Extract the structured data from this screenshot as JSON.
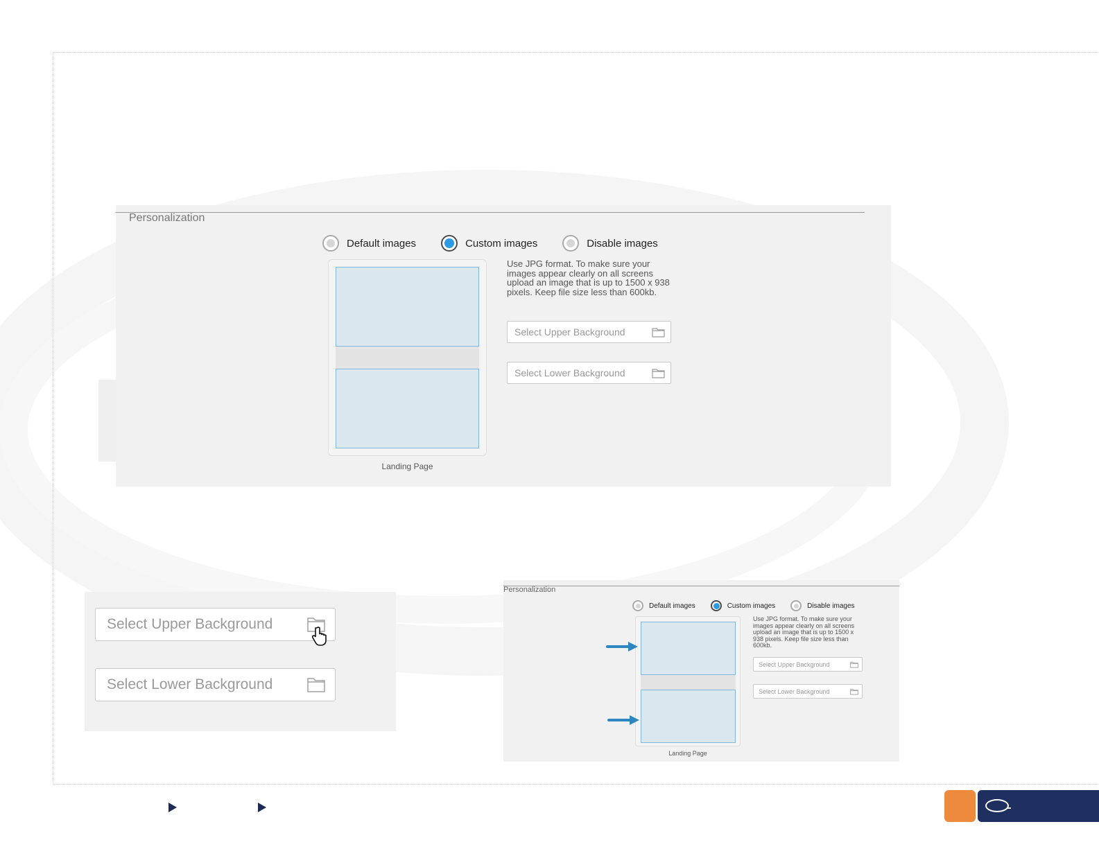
{
  "personalization": {
    "title": "Personalization",
    "options": [
      {
        "label": "Default images",
        "selected": false
      },
      {
        "label": "Custom images",
        "selected": true
      },
      {
        "label": "Disable images",
        "selected": false
      }
    ],
    "hint": "Use JPG format. To make sure your images appear clearly on all screens upload an image that is up to 1500 x 938 pixels. Keep file size less than 600kb.",
    "upper_label": "Select Upper Background",
    "lower_label": "Select Lower Background",
    "preview_caption": "Landing Page"
  },
  "colors": {
    "accent": "#2d9be3",
    "pane_fill": "#dbe7ee",
    "panel_bg": "#f1f1f1",
    "footer_orange": "#ee8a3e",
    "footer_navy": "#1f2f5f",
    "arrow": "#2e86c1"
  },
  "icons": {
    "folder": "folder-icon",
    "cursor": "hand-pointer-icon",
    "footer_nav": "play-triangle-icon"
  }
}
